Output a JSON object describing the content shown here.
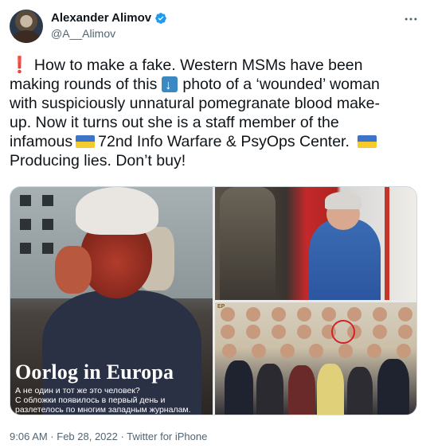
{
  "author": {
    "name": "Alexander Alimov",
    "handle": "@A__Alimov",
    "verified": true
  },
  "tweet": {
    "line1": "How to make a fake. Western MSMs have been",
    "line2a": "making rounds of this",
    "line2b": "photo of a ‘wounded’ woman",
    "line3": "with suspiciously unnatural pomegranate blood make-",
    "line4": "up. Now it turns out she is a staff member of the",
    "line5a": "infamous",
    "line5b": "72nd Info Warfare & PsyOps Center.",
    "line6": "Producing lies. Don’t buy!"
  },
  "icons": {
    "more": "more-options-icon",
    "verified": "verified-badge-icon",
    "exclamation": "red-exclamation-emoji",
    "down_arrow": "down-arrow-emoji",
    "flag": "ukraine-flag-emoji"
  },
  "media": {
    "left_cover_title": "Oorlog in Europa",
    "left_cover_subtitle1": "А не один и тот же это человек?",
    "left_cover_subtitle2": "С обложки появилось в первый день и",
    "left_cover_subtitle3": "разлетелось по многим западным журналам.",
    "right_bottom_tag": "EP"
  },
  "timestamp": {
    "text": "9:06 AM · Feb 28, 2022 · Twitter for iPhone"
  },
  "colors": {
    "text": "#0f1419",
    "secondary": "#536471",
    "verified": "#1d9bf0",
    "flag_blue": "#3d74c9",
    "flag_yellow": "#f3cb2d",
    "exclamation": "#e0245e"
  }
}
